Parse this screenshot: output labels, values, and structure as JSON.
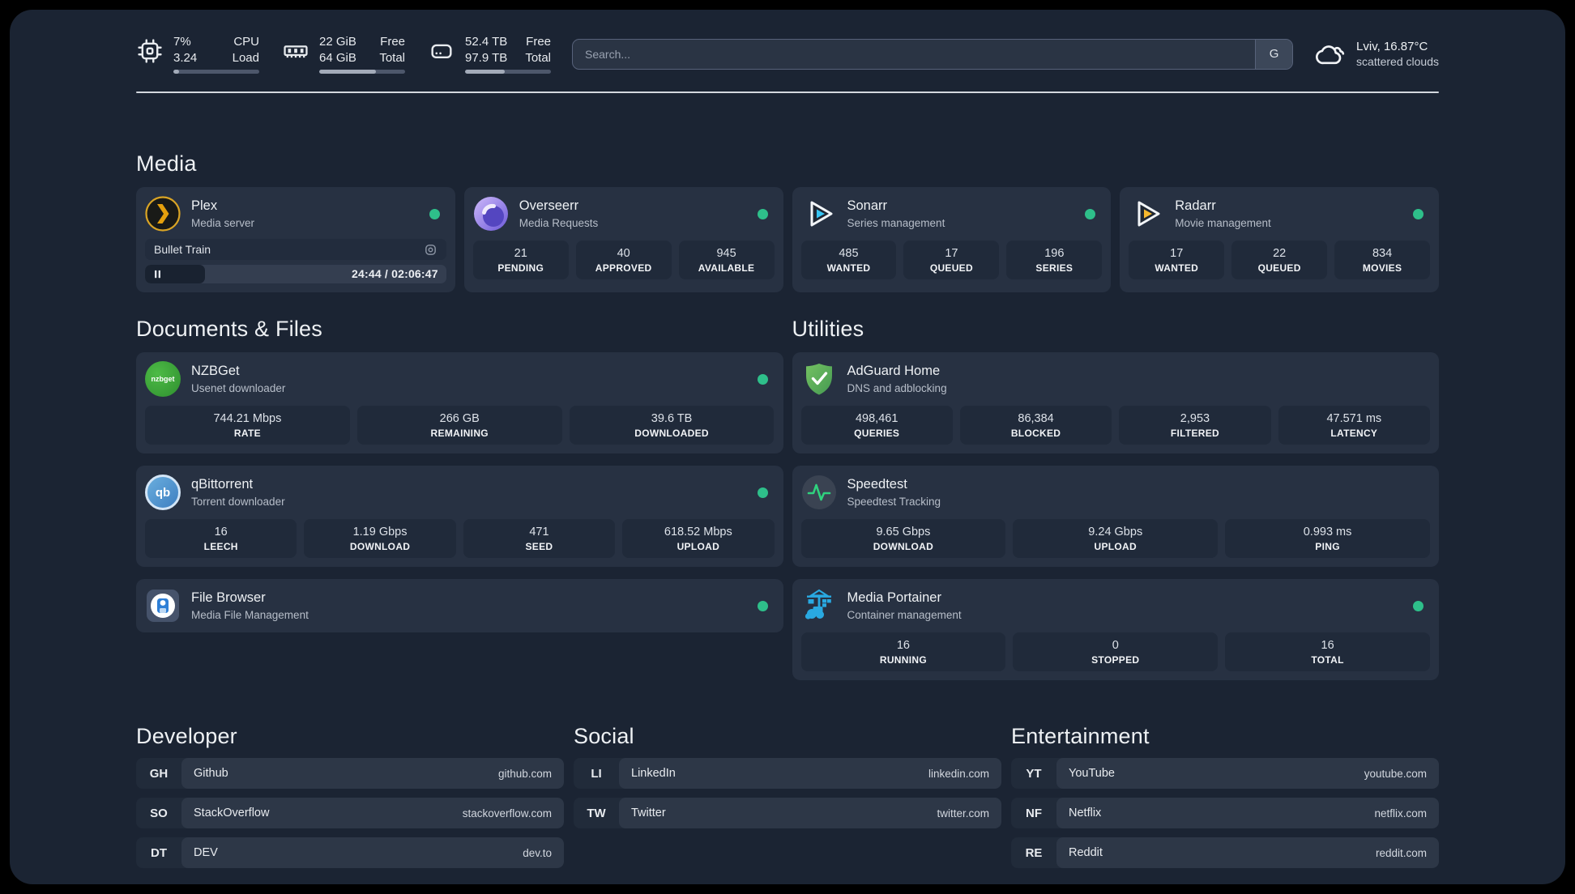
{
  "header": {
    "metrics": [
      {
        "icon": "cpu",
        "value_top": "7%",
        "value_bottom": "3.24",
        "label_top": "CPU",
        "label_bottom": "Load",
        "progress": 7
      },
      {
        "icon": "ram",
        "value_top": "22 GiB",
        "value_bottom": "64 GiB",
        "label_top": "Free",
        "label_bottom": "Total",
        "progress": 66
      },
      {
        "icon": "disk",
        "value_top": "52.4 TB",
        "value_bottom": "97.9 TB",
        "label_top": "Free",
        "label_bottom": "Total",
        "progress": 46
      }
    ],
    "search": {
      "placeholder": "Search...",
      "engine_button": "G"
    },
    "weather": {
      "location": "Lviv, 16.87°C",
      "condition": "scattered clouds"
    }
  },
  "sections": {
    "media": {
      "title": "Media"
    },
    "documents": {
      "title": "Documents & Files"
    },
    "utilities": {
      "title": "Utilities"
    }
  },
  "apps": {
    "plex": {
      "name": "Plex",
      "subtitle": "Media server",
      "now_playing": "Bullet Train",
      "elapsed": "24:44 / 02:06:47",
      "progress": 20
    },
    "overseerr": {
      "name": "Overseerr",
      "subtitle": "Media Requests",
      "stats": [
        {
          "value": "21",
          "label": "PENDING"
        },
        {
          "value": "40",
          "label": "APPROVED"
        },
        {
          "value": "945",
          "label": "AVAILABLE"
        }
      ]
    },
    "sonarr": {
      "name": "Sonarr",
      "subtitle": "Series management",
      "stats": [
        {
          "value": "485",
          "label": "WANTED"
        },
        {
          "value": "17",
          "label": "QUEUED"
        },
        {
          "value": "196",
          "label": "SERIES"
        }
      ]
    },
    "radarr": {
      "name": "Radarr",
      "subtitle": "Movie management",
      "stats": [
        {
          "value": "17",
          "label": "WANTED"
        },
        {
          "value": "22",
          "label": "QUEUED"
        },
        {
          "value": "834",
          "label": "MOVIES"
        }
      ]
    },
    "nzbget": {
      "name": "NZBGet",
      "subtitle": "Usenet downloader",
      "icon_text": "nzbget",
      "stats": [
        {
          "value": "744.21 Mbps",
          "label": "RATE"
        },
        {
          "value": "266 GB",
          "label": "REMAINING"
        },
        {
          "value": "39.6 TB",
          "label": "DOWNLOADED"
        }
      ]
    },
    "qbittorrent": {
      "name": "qBittorrent",
      "subtitle": "Torrent downloader",
      "icon_text": "qb",
      "stats": [
        {
          "value": "16",
          "label": "LEECH"
        },
        {
          "value": "1.19 Gbps",
          "label": "DOWNLOAD"
        },
        {
          "value": "471",
          "label": "SEED"
        },
        {
          "value": "618.52 Mbps",
          "label": "UPLOAD"
        }
      ]
    },
    "filebrowser": {
      "name": "File Browser",
      "subtitle": "Media File Management"
    },
    "adguard": {
      "name": "AdGuard Home",
      "subtitle": "DNS and adblocking",
      "stats": [
        {
          "value": "498,461",
          "label": "QUERIES"
        },
        {
          "value": "86,384",
          "label": "BLOCKED"
        },
        {
          "value": "2,953",
          "label": "FILTERED"
        },
        {
          "value": "47.571 ms",
          "label": "LATENCY"
        }
      ]
    },
    "speedtest": {
      "name": "Speedtest",
      "subtitle": "Speedtest Tracking",
      "stats": [
        {
          "value": "9.65 Gbps",
          "label": "DOWNLOAD"
        },
        {
          "value": "9.24 Gbps",
          "label": "UPLOAD"
        },
        {
          "value": "0.993 ms",
          "label": "PING"
        }
      ]
    },
    "portainer": {
      "name": "Media Portainer",
      "subtitle": "Container management",
      "stats": [
        {
          "value": "16",
          "label": "RUNNING"
        },
        {
          "value": "0",
          "label": "STOPPED"
        },
        {
          "value": "16",
          "label": "TOTAL"
        }
      ]
    }
  },
  "bookmarks": {
    "developer": {
      "title": "Developer",
      "items": [
        {
          "abbr": "GH",
          "name": "Github",
          "url": "github.com"
        },
        {
          "abbr": "SO",
          "name": "StackOverflow",
          "url": "stackoverflow.com"
        },
        {
          "abbr": "DT",
          "name": "DEV",
          "url": "dev.to"
        }
      ]
    },
    "social": {
      "title": "Social",
      "items": [
        {
          "abbr": "LI",
          "name": "LinkedIn",
          "url": "linkedin.com"
        },
        {
          "abbr": "TW",
          "name": "Twitter",
          "url": "twitter.com"
        }
      ]
    },
    "entertainment": {
      "title": "Entertainment",
      "items": [
        {
          "abbr": "YT",
          "name": "YouTube",
          "url": "youtube.com"
        },
        {
          "abbr": "NF",
          "name": "Netflix",
          "url": "netflix.com"
        },
        {
          "abbr": "RE",
          "name": "Reddit",
          "url": "reddit.com"
        }
      ]
    }
  },
  "colors": {
    "status_online": "#2ebf8a",
    "accent_plex": "#e5a00d"
  }
}
